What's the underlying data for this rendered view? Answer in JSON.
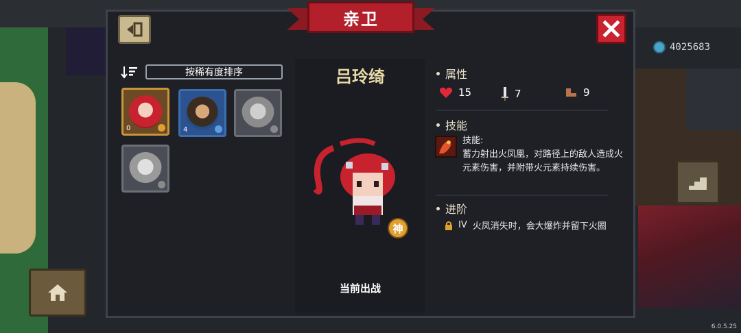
{
  "window": {
    "title": "亲卫"
  },
  "currency": {
    "amount": "4025683",
    "icon": "gem-icon"
  },
  "version": "6.0.5.25",
  "sort": {
    "label": "按稀有度排序"
  },
  "roster": [
    {
      "count": "0",
      "selected": true,
      "locked": false
    },
    {
      "count": "4",
      "selected": false,
      "locked": false
    },
    {
      "count": "",
      "selected": false,
      "locked": true
    },
    {
      "count": "",
      "selected": false,
      "locked": true
    }
  ],
  "hero": {
    "name": "吕玲绮",
    "badge": "神",
    "deploy_label": "当前出战"
  },
  "attributes": {
    "heading": "属性",
    "hp": "15",
    "attack": "7",
    "speed": "9"
  },
  "skill": {
    "heading": "技能",
    "title": "技能:",
    "description": "蓄力射出火凤凰，对路径上的敌人造成火元素伤害，并附带火元素持续伤害。"
  },
  "advance": {
    "heading": "进阶",
    "tier": "IV",
    "text": "火凤消失时，会大爆炸并留下火圈"
  },
  "colors": {
    "accent": "#b3202b",
    "gold": "#e8d9a8",
    "panel": "#1e2026"
  }
}
